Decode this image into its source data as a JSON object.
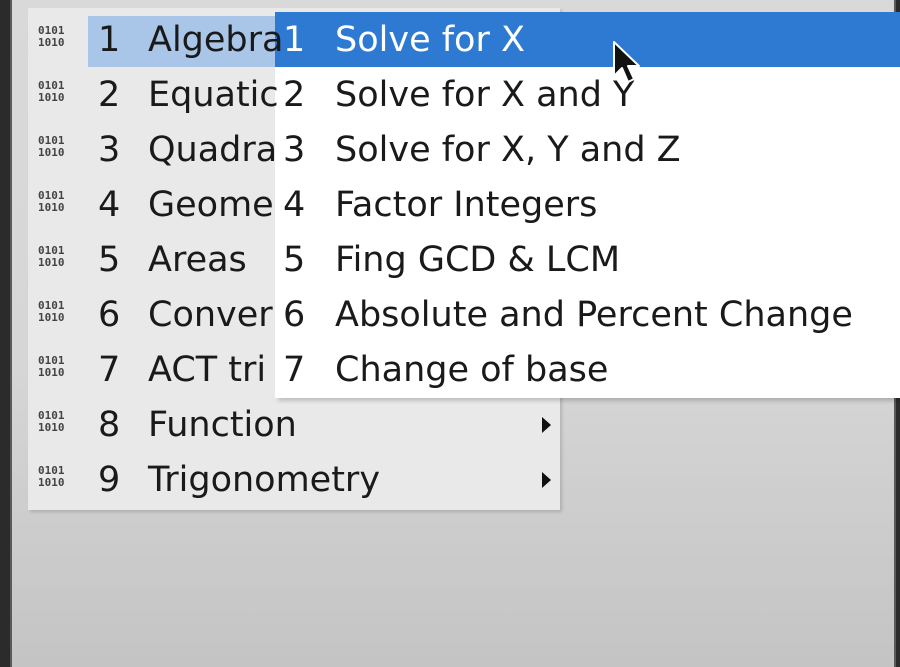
{
  "main_menu": {
    "items": [
      {
        "num": "1",
        "label": "Algebra"
      },
      {
        "num": "2",
        "label": "Equatic"
      },
      {
        "num": "3",
        "label": "Quadra"
      },
      {
        "num": "4",
        "label": "Geome"
      },
      {
        "num": "5",
        "label": "Areas"
      },
      {
        "num": "6",
        "label": "Conver"
      },
      {
        "num": "7",
        "label": "ACT tri"
      },
      {
        "num": "8",
        "label": "Function"
      },
      {
        "num": "9",
        "label": "Trigonometry"
      }
    ],
    "icon_glyph": "0101\n1010"
  },
  "submenu": {
    "items": [
      {
        "num": "1",
        "label": "Solve for X"
      },
      {
        "num": "2",
        "label": "Solve for X and Y"
      },
      {
        "num": "3",
        "label": "Solve for X, Y and Z"
      },
      {
        "num": "4",
        "label": "Factor Integers"
      },
      {
        "num": "5",
        "label": "Fing GCD & LCM"
      },
      {
        "num": "6",
        "label": "Absolute and Percent Change"
      },
      {
        "num": "7",
        "label": "Change of base"
      }
    ]
  },
  "colors": {
    "selection_blue": "#2e7ad2",
    "parent_highlight": "#a9c6e8"
  }
}
